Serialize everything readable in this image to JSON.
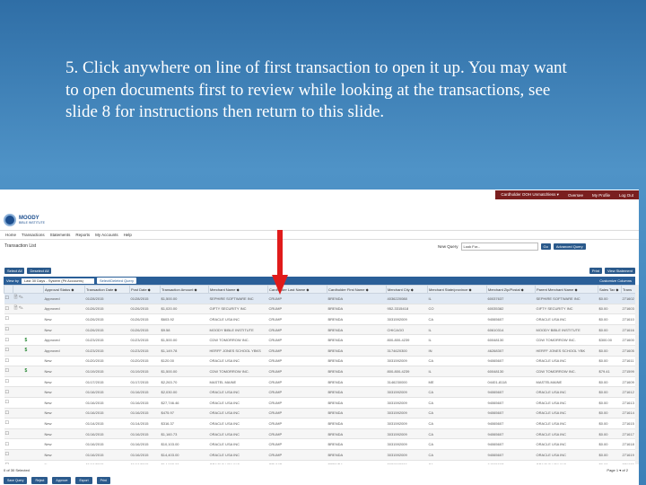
{
  "instruction": "5.  Click anywhere on line of first transaction to open it up. You may want to open documents first to review while looking at the transactions, see slide 8 for instructions then return to this slide.",
  "colors": {
    "accent": "#2a5f98",
    "arrow": "#e01b1b",
    "toplinks_bg": "#7a1f1f"
  },
  "header": {
    "logo_text": "MOODY",
    "logo_sub": "BIBLE INSTITUTE",
    "top_links": [
      "Cardholder OOH Unmatchless ▾",
      "Oversee",
      "My Profile",
      "Log Out"
    ]
  },
  "nav": [
    "Home",
    "Transactions",
    "Statements",
    "Reports",
    "My Accounts",
    "Help"
  ],
  "page_title": "Transaction List",
  "saved_query": {
    "label": "New Query",
    "value": "Look For...",
    "go": "Go",
    "advanced": "Advanced Query"
  },
  "toolbar": {
    "select_all": "Select All",
    "deselect_all": "Deselect All",
    "print": "Print",
    "view_statement": "View Statement"
  },
  "filter": {
    "label": "View by",
    "value": "Last 30 Days - System (Pit Accounts)",
    "select_query": "Select/Deleted Query",
    "customize": "Customize Columns"
  },
  "columns": [
    "",
    "",
    "Approval Status ◆",
    "Transaction Date ◆",
    "Post Date ◆",
    "Transaction Amount ◆",
    "Merchant Name ◆",
    "Cardholder Last Name ◆",
    "Cardholder First Name ◆",
    "Merchant City ◆",
    "Merchant State/province ◆",
    "Merchant Zip/Postal ◆",
    "Parent Merchant Name ◆",
    "Sales Tax ◆",
    "Trans"
  ],
  "rows": [
    {
      "icons": "doc clip",
      "status": "Approved",
      "tdate": "01/28/2015",
      "pdate": "01/28/2015",
      "amount": "$1,500.00",
      "merchant": "SEPHIRE SOFTWARE INC",
      "last": "CRUMP",
      "first": "BRENDA",
      "city": "4036220088",
      "state": "IL",
      "zip": "60037637",
      "parent": "SEPHIRE SOFTWARE INC",
      "tax": "$0.00",
      "trans": "271602"
    },
    {
      "icons": "doc clip",
      "status": "Approved",
      "tdate": "01/26/2015",
      "pdate": "01/26/2015",
      "amount": "$1,020.00",
      "merchant": "GIFTY SECURITY INC",
      "last": "CRUMP",
      "first": "BRENDA",
      "city": "952-3315418",
      "state": "CO",
      "zip": "60035382",
      "parent": "GIFTY SECURITY INC",
      "tax": "$0.00",
      "trans": "271603"
    },
    {
      "icons": "",
      "status": "New",
      "tdate": "01/26/2015",
      "pdate": "01/26/2015",
      "amount": "$603.92",
      "merchant": "ORACLE USA INC",
      "last": "CRUMP",
      "first": "BRENDA",
      "city": "3031592009",
      "state": "CA",
      "zip": "94065607",
      "parent": "ORACLE USA INC",
      "tax": "$0.00",
      "trans": "271610"
    },
    {
      "icons": "",
      "status": "New",
      "tdate": "01/26/2015",
      "pdate": "01/26/2015",
      "amount": "$9.58",
      "merchant": "MOODY BIBLE INSTITUTE",
      "last": "CRUMP",
      "first": "BRENDA",
      "city": "CHICAGO",
      "state": "IL",
      "zip": "60610314",
      "parent": "MOODY BIBLE INSTITUTE",
      "tax": "$0.00",
      "trans": "271616"
    },
    {
      "icons": "dollar",
      "status": "Approved",
      "tdate": "01/23/2015",
      "pdate": "01/23/2015",
      "amount": "$1,500.00",
      "merchant": "CDW TOMORROW INC.",
      "last": "CRUMP",
      "first": "BRENDA",
      "city": "800-800-4239",
      "state": "IL",
      "zip": "60048130",
      "parent": "CDW TOMORROW INC.",
      "tax": "$300.00",
      "trans": "271600"
    },
    {
      "icons": "dollar",
      "status": "Approved",
      "tdate": "01/23/2015",
      "pdate": "01/23/2015",
      "amount": "$1,149.78",
      "merchant": "HERFF JONES SCHOOL YBKS",
      "last": "CRUMP",
      "first": "BRENDA",
      "city": "3174620300",
      "state": "IN",
      "zip": "46268307",
      "parent": "HERFF JONES SCHOOL YBK",
      "tax": "$0.00",
      "trans": "271605"
    },
    {
      "icons": "",
      "status": "New",
      "tdate": "01/20/2015",
      "pdate": "01/20/2015",
      "amount": "$120.00",
      "merchant": "ORACLE USA INC",
      "last": "CRUMP",
      "first": "BRENDA",
      "city": "3031592009",
      "state": "CA",
      "zip": "94065607",
      "parent": "ORACLE USA INC",
      "tax": "$0.00",
      "trans": "271611"
    },
    {
      "icons": "dollar",
      "status": "New",
      "tdate": "01/19/2015",
      "pdate": "01/19/2015",
      "amount": "$1,500.00",
      "merchant": "CDW TOMORROW INC.",
      "last": "CRUMP",
      "first": "BRENDA",
      "city": "800-800-4239",
      "state": "IL",
      "zip": "60048130",
      "parent": "CDW TOMORROW INC.",
      "tax": "$79.41",
      "trans": "271599"
    },
    {
      "icons": "",
      "status": "New",
      "tdate": "01/17/2015",
      "pdate": "01/17/2015",
      "amount": "$2,263.70",
      "merchant": "MASTEL MAINE",
      "last": "CRUMP",
      "first": "BRENDA",
      "city": "3146230000",
      "state": "ME",
      "zip": "04401-8118",
      "parent": "MASTELMAINE",
      "tax": "$0.00",
      "trans": "271609"
    },
    {
      "icons": "",
      "status": "New",
      "tdate": "01/16/2015",
      "pdate": "01/16/2015",
      "amount": "$2,030.00",
      "merchant": "ORACLE USA INC",
      "last": "CRUMP",
      "first": "BRENDA",
      "city": "3031592009",
      "state": "CA",
      "zip": "94065607",
      "parent": "ORACLE USA INC",
      "tax": "$0.00",
      "trans": "271612"
    },
    {
      "icons": "",
      "status": "New",
      "tdate": "01/16/2015",
      "pdate": "01/16/2015",
      "amount": "$27,746.46",
      "merchant": "ORACLE USA INC",
      "last": "CRUMP",
      "first": "BRENDA",
      "city": "3031592009",
      "state": "CA",
      "zip": "94065607",
      "parent": "ORACLE USA INC",
      "tax": "$0.00",
      "trans": "271613"
    },
    {
      "icons": "",
      "status": "New",
      "tdate": "01/16/2015",
      "pdate": "01/16/2015",
      "amount": "$475.97",
      "merchant": "ORACLE USA INC",
      "last": "CRUMP",
      "first": "BRENDA",
      "city": "3031592009",
      "state": "CA",
      "zip": "94065607",
      "parent": "ORACLE USA INC",
      "tax": "$0.00",
      "trans": "271614"
    },
    {
      "icons": "",
      "status": "New",
      "tdate": "01/14/2015",
      "pdate": "01/14/2015",
      "amount": "$316.37",
      "merchant": "ORACLE USA INC",
      "last": "CRUMP",
      "first": "BRENDA",
      "city": "3031592009",
      "state": "CA",
      "zip": "94065607",
      "parent": "ORACLE USA INC",
      "tax": "$0.00",
      "trans": "271615"
    },
    {
      "icons": "",
      "status": "New",
      "tdate": "01/16/2015",
      "pdate": "01/16/2015",
      "amount": "$1,160.73",
      "merchant": "ORACLE USA INC",
      "last": "CRUMP",
      "first": "BRENDA",
      "city": "3031592009",
      "state": "CA",
      "zip": "94065607",
      "parent": "ORACLE USA INC",
      "tax": "$0.00",
      "trans": "271617"
    },
    {
      "icons": "",
      "status": "New",
      "tdate": "01/16/2015",
      "pdate": "01/16/2015",
      "amount": "$10,103.00",
      "merchant": "ORACLE USA INC",
      "last": "CRUMP",
      "first": "BRENDA",
      "city": "3031592009",
      "state": "CA",
      "zip": "94065607",
      "parent": "ORACLE USA INC",
      "tax": "$0.00",
      "trans": "271618"
    },
    {
      "icons": "",
      "status": "New",
      "tdate": "01/16/2015",
      "pdate": "01/16/2015",
      "amount": "$14,403.00",
      "merchant": "ORACLE USA INC",
      "last": "CRUMP",
      "first": "BRENDA",
      "city": "3031592009",
      "state": "CA",
      "zip": "94065607",
      "parent": "ORACLE USA INC",
      "tax": "$0.00",
      "trans": "271619"
    },
    {
      "icons": "",
      "status": "New",
      "tdate": "01/16/2015",
      "pdate": "01/16/2015",
      "amount": "$14,903.00",
      "merchant": "ORACLE USA INC",
      "last": "CRUMP",
      "first": "BRENDA",
      "city": "3031592009",
      "state": "CA",
      "zip": "94065607",
      "parent": "ORACLE USA INC",
      "tax": "$0.00",
      "trans": "271620"
    }
  ],
  "footer": {
    "selected": "0 of 30 Selected",
    "page": "Page  1  ▾  of 2",
    "buttons": [
      "Save Query",
      "Reject",
      "Approve",
      "Export",
      "Print"
    ]
  }
}
